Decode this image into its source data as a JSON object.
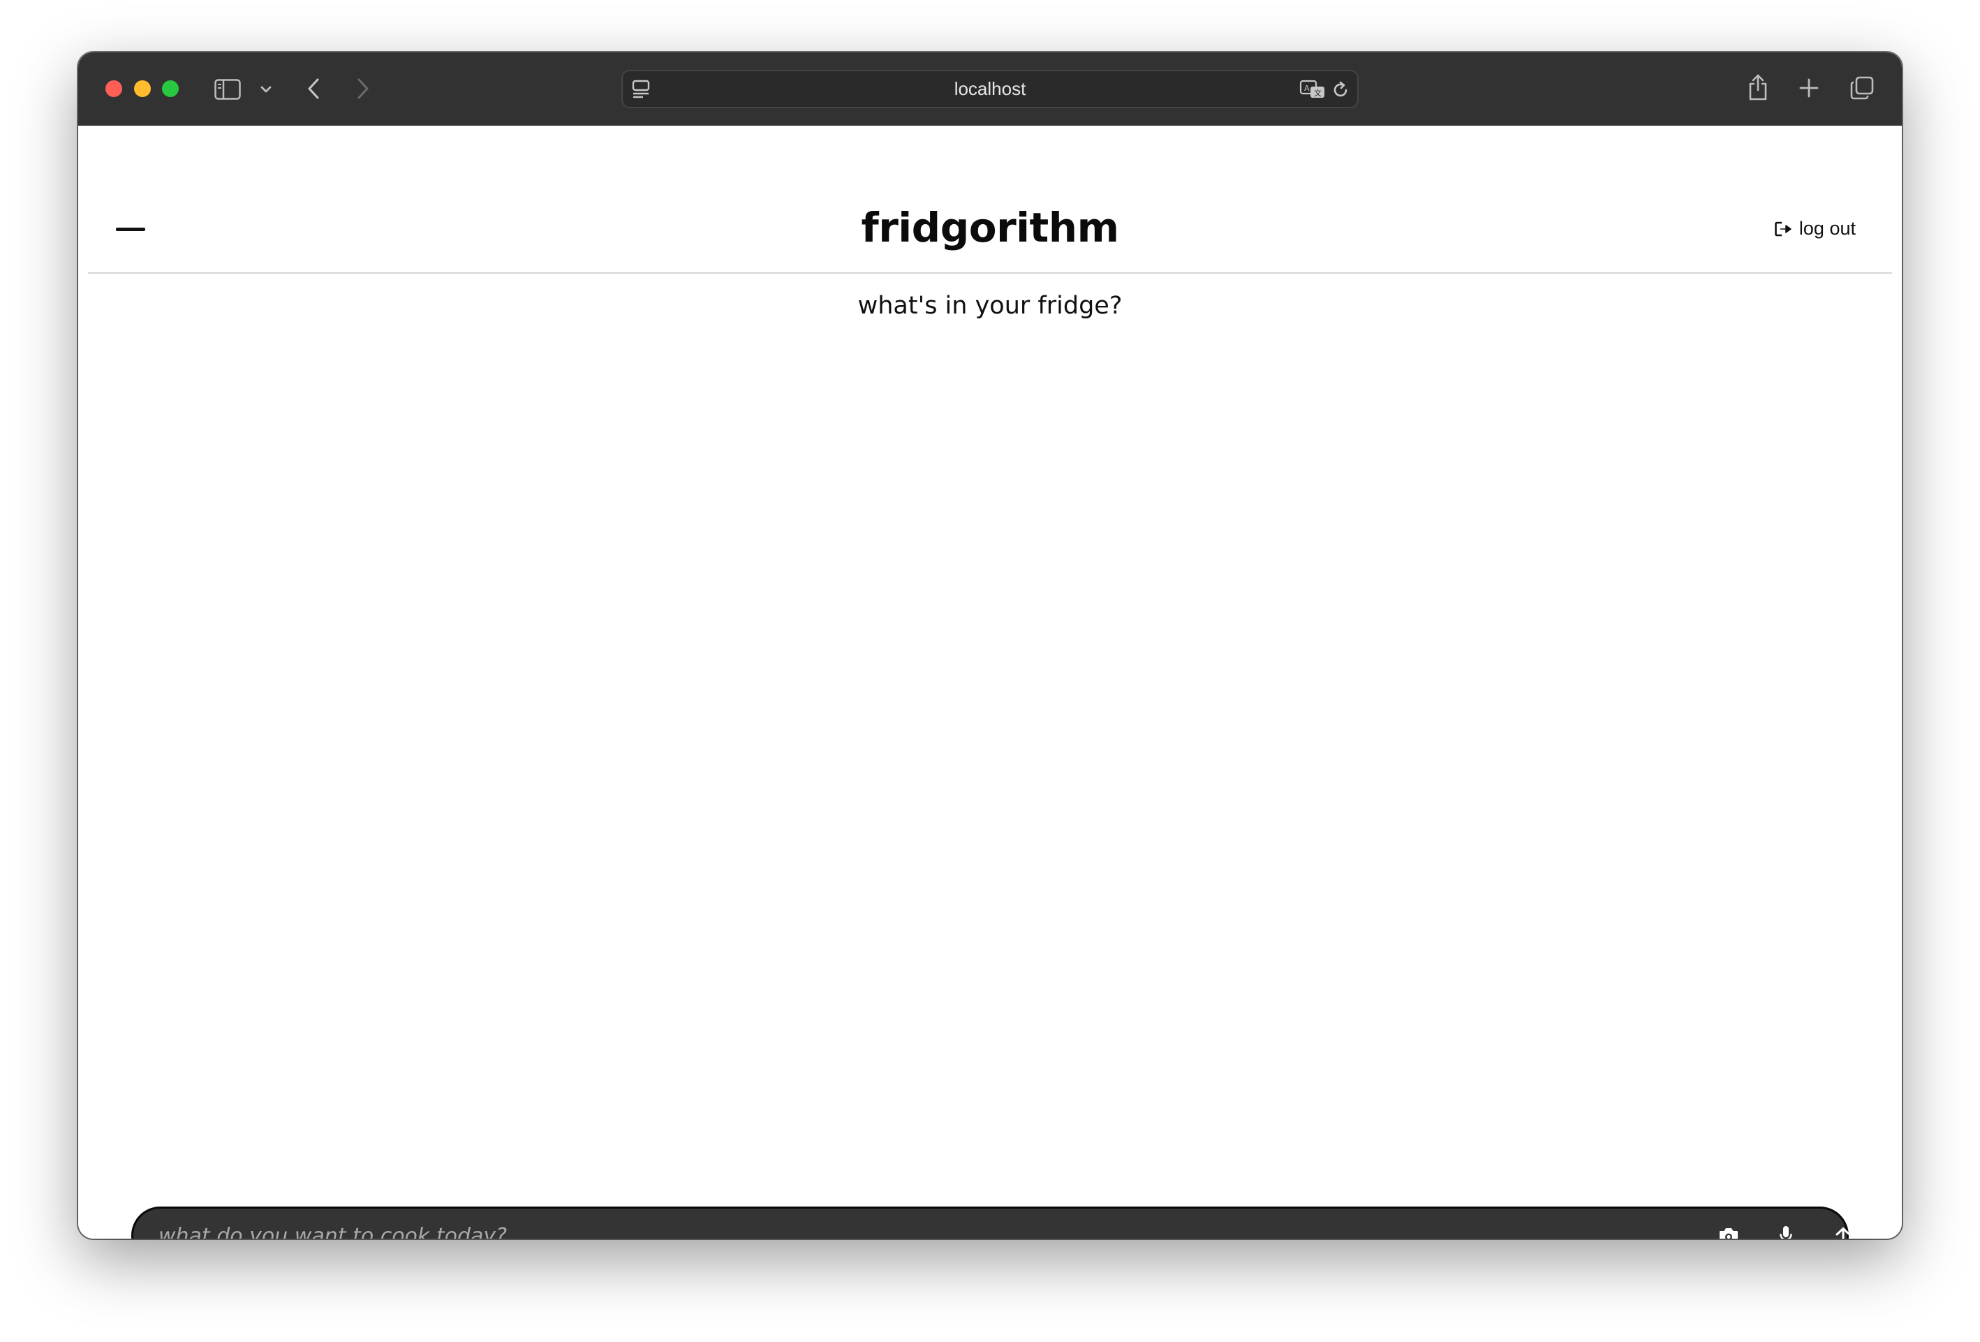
{
  "browser": {
    "url": "localhost"
  },
  "app": {
    "brand": "fridgorithm",
    "logout_label": "log out",
    "heading": "what's in your fridge?",
    "chat": {
      "placeholder": "what do you want to cook today?"
    }
  },
  "icons": {
    "sidebar": "sidebar-icon",
    "chevron": "chevron-down-icon",
    "back": "back-arrow-icon",
    "forward": "forward-arrow-icon",
    "reader": "reader-icon",
    "translate": "translate-icon",
    "reload": "reload-icon",
    "share": "share-icon",
    "new_tab": "plus-icon",
    "tabs": "tabs-overview-icon",
    "menu": "menu-icon",
    "logout": "logout-icon",
    "camera": "camera-icon",
    "microphone": "microphone-icon",
    "send": "arrow-up-icon"
  },
  "colors": {
    "titlebar": "#323232",
    "chatbar": "#343434",
    "close": "#ff5f57",
    "minimize": "#febc2e",
    "maximize": "#28c840"
  }
}
